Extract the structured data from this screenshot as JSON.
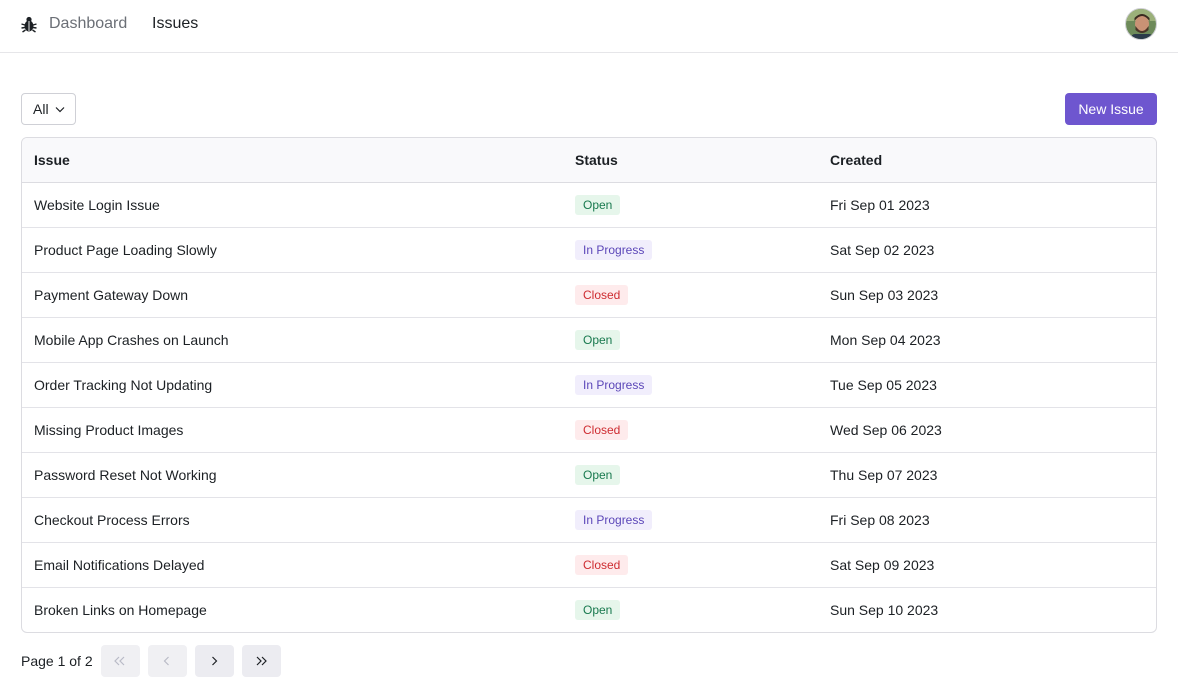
{
  "nav": {
    "logo_icon": "bug-icon",
    "dashboard_label": "Dashboard",
    "issues_label": "Issues",
    "avatar_icon": "user-avatar"
  },
  "toolbar": {
    "filter_value": "All",
    "new_issue_label": "New Issue"
  },
  "table": {
    "columns": [
      "Issue",
      "Status",
      "Created"
    ],
    "rows": [
      {
        "title": "Website Login Issue",
        "status": "Open",
        "created": "Fri Sep 01 2023"
      },
      {
        "title": "Product Page Loading Slowly",
        "status": "In Progress",
        "created": "Sat Sep 02 2023"
      },
      {
        "title": "Payment Gateway Down",
        "status": "Closed",
        "created": "Sun Sep 03 2023"
      },
      {
        "title": "Mobile App Crashes on Launch",
        "status": "Open",
        "created": "Mon Sep 04 2023"
      },
      {
        "title": "Order Tracking Not Updating",
        "status": "In Progress",
        "created": "Tue Sep 05 2023"
      },
      {
        "title": "Missing Product Images",
        "status": "Closed",
        "created": "Wed Sep 06 2023"
      },
      {
        "title": "Password Reset Not Working",
        "status": "Open",
        "created": "Thu Sep 07 2023"
      },
      {
        "title": "Checkout Process Errors",
        "status": "In Progress",
        "created": "Fri Sep 08 2023"
      },
      {
        "title": "Email Notifications Delayed",
        "status": "Closed",
        "created": "Sat Sep 09 2023"
      },
      {
        "title": "Broken Links on Homepage",
        "status": "Open",
        "created": "Sun Sep 10 2023"
      }
    ]
  },
  "status_colors": {
    "Open": {
      "bg": "#e6f6eb",
      "fg": "#18794e"
    },
    "In Progress": {
      "bg": "#f1eefc",
      "fg": "#5b46b8"
    },
    "Closed": {
      "bg": "#feebec",
      "fg": "#ce2c31"
    }
  },
  "pagination": {
    "label": "Page 1 of 2",
    "buttons": [
      "double-chevron-left-icon",
      "chevron-left-icon",
      "chevron-right-icon",
      "double-chevron-right-icon"
    ]
  },
  "colors": {
    "accent": "#6e56cf"
  }
}
